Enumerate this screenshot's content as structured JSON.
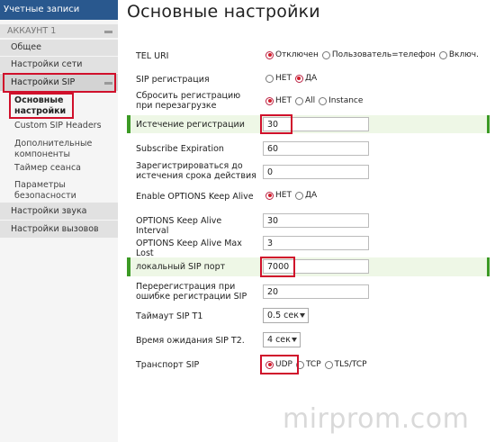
{
  "sidebar": {
    "header": "Учетные записи",
    "account": "АККАУНТ 1",
    "items": {
      "general": "Общее",
      "network": "Настройки сети",
      "sip": "Настройки SIP",
      "basic": "Основные настройки",
      "custom_headers": "Custom SIP Headers",
      "components": "Дополнительные компоненты",
      "session_timer": "Таймер сеанса",
      "security": "Параметры безопасности",
      "audio": "Настройки звука",
      "calls": "Настройки вызовов"
    }
  },
  "main": {
    "title": "Основные настройки",
    "tel_uri": {
      "label": "TEL URI",
      "options": [
        "Отключен",
        "Пользователь=телефон",
        "Включ."
      ],
      "selected": 0
    },
    "sip_registration": {
      "label": "SIP регистрация",
      "options": [
        "НЕТ",
        "ДА"
      ],
      "selected": 1
    },
    "reset_on_reboot": {
      "label": "Сбросить регистрацию при перезагрузке",
      "options": [
        "НЕТ",
        "All",
        "Instance"
      ],
      "selected": 0
    },
    "reg_expiration": {
      "label": "Истечение регистрации",
      "value": "30"
    },
    "subscribe_expiration": {
      "label": "Subscribe Expiration",
      "value": "60"
    },
    "register_before_expiry": {
      "label": "Зарегистрироваться до истечения срока действия",
      "value": "0"
    },
    "options_keepalive": {
      "label": "Enable OPTIONS Keep Alive",
      "options": [
        "НЕТ",
        "ДА"
      ],
      "selected": 0
    },
    "options_interval": {
      "label": "OPTIONS Keep Alive Interval",
      "value": "30"
    },
    "options_max_lost": {
      "label": "OPTIONS Keep Alive Max Lost",
      "value": "3"
    },
    "local_sip_port": {
      "label": "локальный SIP порт",
      "value": "7000"
    },
    "reregister_on_error": {
      "label": "Перерегистрация при ошибке регистрации SIP",
      "value": "20"
    },
    "timeout_t1": {
      "label": "Таймаут SIP T1",
      "value": "0.5 сек"
    },
    "wait_t2": {
      "label": "Время ожидания SIP T2.",
      "value": "4 сек"
    },
    "transport": {
      "label": "Транспорт SIP",
      "options": [
        "UDP",
        "TCP",
        "TLS/TCP"
      ],
      "selected": 0
    }
  },
  "watermark": "mirprom.com",
  "colors": {
    "sidebar_header": "#29588e",
    "highlight": "#3c9a25",
    "callout": "#d0102b",
    "radio_on": "#d21f2b"
  }
}
